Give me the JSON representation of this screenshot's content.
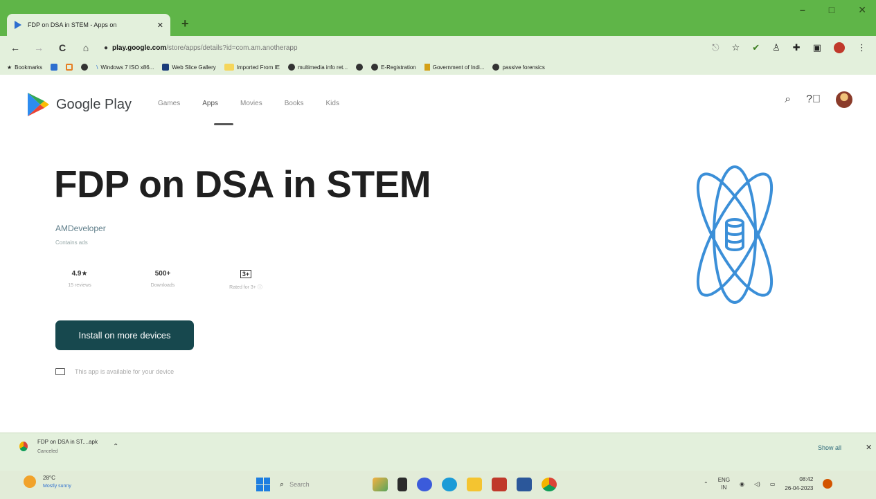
{
  "browser": {
    "tab_title": "FDP on DSA in STEM - Apps on",
    "tab_close": "✕",
    "new_tab": "+",
    "window_controls": [
      "–",
      "□",
      "✕"
    ],
    "address": {
      "host": "play.google.com",
      "path": "/store/apps/details?id=com.am.anotherapp"
    },
    "bookmarks": [
      {
        "label": "Bookmarks",
        "icon": "star-icon"
      },
      {
        "label": "",
        "icon": "gmail-icon"
      },
      {
        "label": "",
        "icon": "office-icon"
      },
      {
        "label": "",
        "icon": "github-icon"
      },
      {
        "label": "Windows 7 ISO x86...",
        "icon": "bookmark-icon"
      },
      {
        "label": "Web Slice Gallery",
        "icon": "web-slice-icon"
      },
      {
        "label": "Imported From IE",
        "icon": "folder-icon"
      },
      {
        "label": "multimedia info ret...",
        "icon": "github-icon"
      },
      {
        "label": "",
        "icon": "github-icon"
      },
      {
        "label": "E-Registration",
        "icon": "github-icon"
      },
      {
        "label": "Government of Indi...",
        "icon": "emblem-icon"
      },
      {
        "label": "passive forensics",
        "icon": "github-icon"
      }
    ]
  },
  "play": {
    "brand": "Google Play",
    "nav_tabs": [
      "Games",
      "Apps",
      "Movies",
      "Books",
      "Kids"
    ],
    "active_tab": "Apps"
  },
  "app": {
    "title": "FDP on DSA in STEM",
    "developer": "AMDeveloper",
    "ads_note": "Contains ads",
    "stats": [
      {
        "value": "4.9★",
        "label": "15 reviews"
      },
      {
        "value": "500+",
        "label": "Downloads"
      },
      {
        "value": "3+",
        "label": "Rated for 3+ ⓘ"
      }
    ],
    "install_label": "Install on more devices",
    "availability": "This app is available for your device",
    "accent_color": "#3b8fd8"
  },
  "downloads": {
    "file_name": "FDP on DSA in ST....apk",
    "status": "Canceled",
    "show_all": "Show all",
    "close": "✕"
  },
  "taskbar": {
    "weather_temp": "28°C",
    "weather_cond": "Mostly sunny",
    "search_label": "Search",
    "lang_top": "ENG",
    "lang_bottom": "IN",
    "time": "08:42",
    "date": "26-04-2023"
  }
}
